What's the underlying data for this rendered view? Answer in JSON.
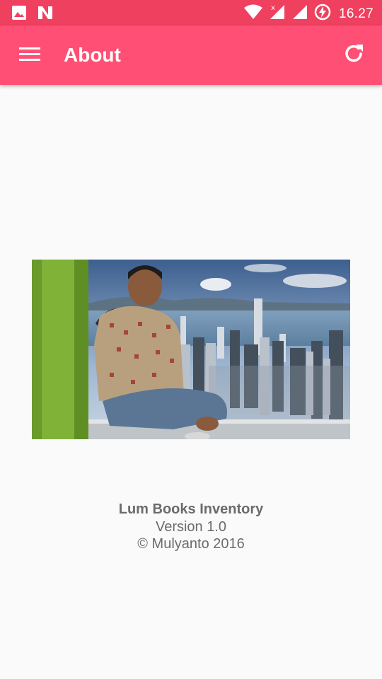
{
  "status_bar": {
    "time": "16.27",
    "icons": [
      "image-notification-icon",
      "n-notification-icon",
      "wifi-icon",
      "signal-no-data-icon",
      "signal-icon",
      "battery-charging-icon"
    ]
  },
  "app_bar": {
    "title": "About",
    "menu_icon": "hamburger-menu-icon",
    "refresh_icon": "refresh-icon"
  },
  "about": {
    "photo_icon": "profile-photo",
    "app_name": "Lum Books Inventory",
    "version": "Version 1.0",
    "copyright": "© Mulyanto 2016"
  },
  "colors": {
    "status_bar": "#f0405f",
    "app_bar": "#ff4f74",
    "background": "#fafafa",
    "text": "#6b6b6b"
  }
}
